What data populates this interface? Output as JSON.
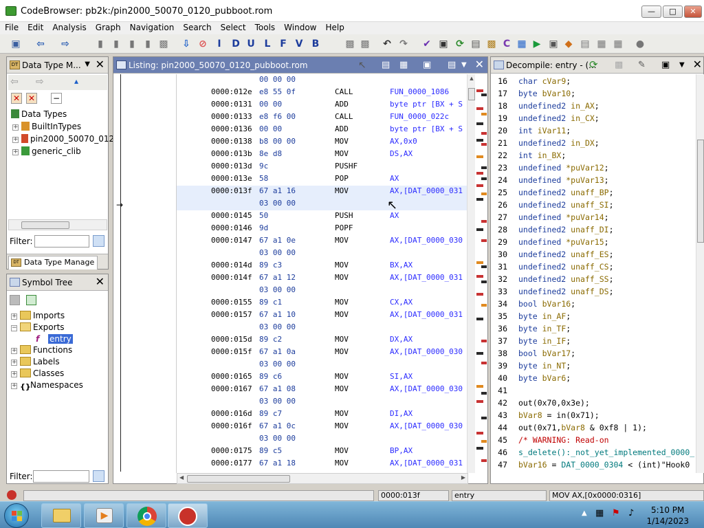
{
  "window": {
    "title": "CodeBrowser: pb2k:/pin2000_50070_0120_pubboot.rom"
  },
  "menu": [
    "File",
    "Edit",
    "Analysis",
    "Graph",
    "Navigation",
    "Search",
    "Select",
    "Tools",
    "Window",
    "Help"
  ],
  "toolbar_icons": [
    "save-icon",
    "back-icon",
    "forward-icon",
    "disassemble-icon",
    "clear-icon",
    "flow-icon",
    "instruction-icon",
    "data-icon",
    "undefined-icon",
    "label-icon",
    "function-icon",
    "variable-icon",
    "bookmark-icon",
    "undo-icon",
    "redo-icon",
    "checkmark-icon",
    "search-icon",
    "code-icon",
    "data-type-manager-icon",
    "run-icon",
    "debug-icon"
  ],
  "toolbar_letters": {
    "I": "I",
    "D": "D",
    "U": "U",
    "L": "L",
    "F": "F",
    "V": "V",
    "B": "B"
  },
  "datatype": {
    "title": "Data Type M...",
    "tab_label": "Data Type Manage",
    "filter_label": "Filter:",
    "items": [
      {
        "label": "Data Types"
      },
      {
        "label": "BuiltInTypes"
      },
      {
        "label": "pin2000_50070_012"
      },
      {
        "label": "generic_clib"
      }
    ]
  },
  "symbol_tree": {
    "title": "Symbol Tree",
    "filter_label": "Filter:",
    "items": [
      {
        "label": "Imports"
      },
      {
        "label": "Exports"
      },
      {
        "label": "entry"
      },
      {
        "label": "Functions"
      },
      {
        "label": "Labels"
      },
      {
        "label": "Classes"
      },
      {
        "label": "Namespaces"
      }
    ]
  },
  "listing": {
    "title": "Listing:  pin2000_50070_0120_pubboot.rom",
    "rows": [
      {
        "addr": "",
        "bytes": "00 00 00",
        "mnem": "",
        "ops": ""
      },
      {
        "addr": "0000:012e",
        "bytes": "e8 55 0f",
        "mnem": "CALL",
        "ops": "FUN_0000_1086"
      },
      {
        "addr": "0000:0131",
        "bytes": "00 00",
        "mnem": "ADD",
        "ops": "byte ptr [BX + S"
      },
      {
        "addr": "0000:0133",
        "bytes": "e8 f6 00",
        "mnem": "CALL",
        "ops": "FUN_0000_022c"
      },
      {
        "addr": "0000:0136",
        "bytes": "00 00",
        "mnem": "ADD",
        "ops": "byte ptr [BX + S"
      },
      {
        "addr": "0000:0138",
        "bytes": "b8 00 00",
        "mnem": "MOV",
        "ops": "AX,0x0"
      },
      {
        "addr": "0000:013b",
        "bytes": "8e d8",
        "mnem": "MOV",
        "ops": "DS,AX"
      },
      {
        "addr": "0000:013d",
        "bytes": "9c",
        "mnem": "PUSHF",
        "ops": ""
      },
      {
        "addr": "0000:013e",
        "bytes": "58",
        "mnem": "POP",
        "ops": "AX"
      },
      {
        "addr": "0000:013f",
        "bytes": "67 a1 16",
        "mnem": "MOV",
        "ops": "AX,[DAT_0000_031"
      },
      {
        "addr": "",
        "bytes": "03 00 00",
        "mnem": "",
        "ops": ""
      },
      {
        "addr": "0000:0145",
        "bytes": "50",
        "mnem": "PUSH",
        "ops": "AX"
      },
      {
        "addr": "0000:0146",
        "bytes": "9d",
        "mnem": "POPF",
        "ops": ""
      },
      {
        "addr": "0000:0147",
        "bytes": "67 a1 0e",
        "mnem": "MOV",
        "ops": "AX,[DAT_0000_030"
      },
      {
        "addr": "",
        "bytes": "03 00 00",
        "mnem": "",
        "ops": ""
      },
      {
        "addr": "0000:014d",
        "bytes": "89 c3",
        "mnem": "MOV",
        "ops": "BX,AX"
      },
      {
        "addr": "0000:014f",
        "bytes": "67 a1 12",
        "mnem": "MOV",
        "ops": "AX,[DAT_0000_031"
      },
      {
        "addr": "",
        "bytes": "03 00 00",
        "mnem": "",
        "ops": ""
      },
      {
        "addr": "0000:0155",
        "bytes": "89 c1",
        "mnem": "MOV",
        "ops": "CX,AX"
      },
      {
        "addr": "0000:0157",
        "bytes": "67 a1 10",
        "mnem": "MOV",
        "ops": "AX,[DAT_0000_031"
      },
      {
        "addr": "",
        "bytes": "03 00 00",
        "mnem": "",
        "ops": ""
      },
      {
        "addr": "0000:015d",
        "bytes": "89 c2",
        "mnem": "MOV",
        "ops": "DX,AX"
      },
      {
        "addr": "0000:015f",
        "bytes": "67 a1 0a",
        "mnem": "MOV",
        "ops": "AX,[DAT_0000_030"
      },
      {
        "addr": "",
        "bytes": "03 00 00",
        "mnem": "",
        "ops": ""
      },
      {
        "addr": "0000:0165",
        "bytes": "89 c6",
        "mnem": "MOV",
        "ops": "SI,AX"
      },
      {
        "addr": "0000:0167",
        "bytes": "67 a1 08",
        "mnem": "MOV",
        "ops": "AX,[DAT_0000_030"
      },
      {
        "addr": "",
        "bytes": "03 00 00",
        "mnem": "",
        "ops": ""
      },
      {
        "addr": "0000:016d",
        "bytes": "89 c7",
        "mnem": "MOV",
        "ops": "DI,AX"
      },
      {
        "addr": "0000:016f",
        "bytes": "67 a1 0c",
        "mnem": "MOV",
        "ops": "AX,[DAT_0000_030"
      },
      {
        "addr": "",
        "bytes": "03 00 00",
        "mnem": "",
        "ops": ""
      },
      {
        "addr": "0000:0175",
        "bytes": "89 c5",
        "mnem": "MOV",
        "ops": "BP,AX"
      },
      {
        "addr": "0000:0177",
        "bytes": "67 a1 18",
        "mnem": "MOV",
        "ops": "AX,[DAT_0000_031"
      }
    ]
  },
  "decompile": {
    "title": "Decompile: entry - (...",
    "rows": [
      {
        "n": "16",
        "code": [
          {
            "t": "char ",
            "c": "kw"
          },
          {
            "t": "cVar9",
            "c": "vr"
          },
          {
            "t": ";",
            "c": ""
          }
        ]
      },
      {
        "n": "17",
        "code": [
          {
            "t": "byte ",
            "c": "kw"
          },
          {
            "t": "bVar10",
            "c": "vr"
          },
          {
            "t": ";",
            "c": ""
          }
        ]
      },
      {
        "n": "18",
        "code": [
          {
            "t": "undefined2 ",
            "c": "kw"
          },
          {
            "t": "in_AX",
            "c": "vr"
          },
          {
            "t": ";",
            "c": ""
          }
        ]
      },
      {
        "n": "19",
        "code": [
          {
            "t": "undefined2 ",
            "c": "kw"
          },
          {
            "t": "in_CX",
            "c": "vr"
          },
          {
            "t": ";",
            "c": ""
          }
        ]
      },
      {
        "n": "20",
        "code": [
          {
            "t": "int ",
            "c": "kw"
          },
          {
            "t": "iVar11",
            "c": "vr"
          },
          {
            "t": ";",
            "c": ""
          }
        ]
      },
      {
        "n": "21",
        "code": [
          {
            "t": "undefined2 ",
            "c": "kw"
          },
          {
            "t": "in_DX",
            "c": "vr"
          },
          {
            "t": ";",
            "c": ""
          }
        ]
      },
      {
        "n": "22",
        "code": [
          {
            "t": "int ",
            "c": "kw"
          },
          {
            "t": "in_BX",
            "c": "vr"
          },
          {
            "t": ";",
            "c": ""
          }
        ]
      },
      {
        "n": "23",
        "code": [
          {
            "t": "undefined ",
            "c": "kw"
          },
          {
            "t": "*puVar12",
            "c": "vr"
          },
          {
            "t": ";",
            "c": ""
          }
        ]
      },
      {
        "n": "24",
        "code": [
          {
            "t": "undefined ",
            "c": "kw"
          },
          {
            "t": "*puVar13",
            "c": "vr"
          },
          {
            "t": ";",
            "c": ""
          }
        ]
      },
      {
        "n": "25",
        "code": [
          {
            "t": "undefined2 ",
            "c": "kw"
          },
          {
            "t": "unaff_BP",
            "c": "vr"
          },
          {
            "t": ";",
            "c": ""
          }
        ]
      },
      {
        "n": "26",
        "code": [
          {
            "t": "undefined2 ",
            "c": "kw"
          },
          {
            "t": "unaff_SI",
            "c": "vr"
          },
          {
            "t": ";",
            "c": ""
          }
        ]
      },
      {
        "n": "27",
        "code": [
          {
            "t": "undefined ",
            "c": "kw"
          },
          {
            "t": "*puVar14",
            "c": "vr"
          },
          {
            "t": ";",
            "c": ""
          }
        ]
      },
      {
        "n": "28",
        "code": [
          {
            "t": "undefined2 ",
            "c": "kw"
          },
          {
            "t": "unaff_DI",
            "c": "vr"
          },
          {
            "t": ";",
            "c": ""
          }
        ]
      },
      {
        "n": "29",
        "code": [
          {
            "t": "undefined ",
            "c": "kw"
          },
          {
            "t": "*puVar15",
            "c": "vr"
          },
          {
            "t": ";",
            "c": ""
          }
        ]
      },
      {
        "n": "30",
        "code": [
          {
            "t": "undefined2 ",
            "c": "kw"
          },
          {
            "t": "unaff_ES",
            "c": "vr"
          },
          {
            "t": ";",
            "c": ""
          }
        ]
      },
      {
        "n": "31",
        "code": [
          {
            "t": "undefined2 ",
            "c": "kw"
          },
          {
            "t": "unaff_CS",
            "c": "vr"
          },
          {
            "t": ";",
            "c": ""
          }
        ]
      },
      {
        "n": "32",
        "code": [
          {
            "t": "undefined2 ",
            "c": "kw"
          },
          {
            "t": "unaff_SS",
            "c": "vr"
          },
          {
            "t": ";",
            "c": ""
          }
        ]
      },
      {
        "n": "33",
        "code": [
          {
            "t": "undefined2 ",
            "c": "kw"
          },
          {
            "t": "unaff_DS",
            "c": "vr"
          },
          {
            "t": ";",
            "c": ""
          }
        ]
      },
      {
        "n": "34",
        "code": [
          {
            "t": "bool ",
            "c": "kw"
          },
          {
            "t": "bVar16",
            "c": "vr"
          },
          {
            "t": ";",
            "c": ""
          }
        ]
      },
      {
        "n": "35",
        "code": [
          {
            "t": "byte ",
            "c": "kw"
          },
          {
            "t": "in_AF",
            "c": "vr"
          },
          {
            "t": ";",
            "c": ""
          }
        ]
      },
      {
        "n": "36",
        "code": [
          {
            "t": "byte ",
            "c": "kw"
          },
          {
            "t": "in_TF",
            "c": "vr"
          },
          {
            "t": ";",
            "c": ""
          }
        ]
      },
      {
        "n": "37",
        "code": [
          {
            "t": "byte ",
            "c": "kw"
          },
          {
            "t": "in_IF",
            "c": "vr"
          },
          {
            "t": ";",
            "c": ""
          }
        ]
      },
      {
        "n": "38",
        "code": [
          {
            "t": "bool ",
            "c": "kw"
          },
          {
            "t": "bVar17",
            "c": "vr"
          },
          {
            "t": ";",
            "c": ""
          }
        ]
      },
      {
        "n": "39",
        "code": [
          {
            "t": "byte ",
            "c": "kw"
          },
          {
            "t": "in_NT",
            "c": "vr"
          },
          {
            "t": ";",
            "c": ""
          }
        ]
      },
      {
        "n": "40",
        "code": [
          {
            "t": "byte ",
            "c": "kw"
          },
          {
            "t": "bVar6",
            "c": "vr"
          },
          {
            "t": ";",
            "c": ""
          }
        ]
      },
      {
        "n": "41",
        "code": []
      },
      {
        "n": "42",
        "code": [
          {
            "t": "out(0x70,0x3e);",
            "c": ""
          }
        ]
      },
      {
        "n": "43",
        "code": [
          {
            "t": "bVar8",
            "c": "vr"
          },
          {
            "t": " = in(0x71);",
            "c": ""
          }
        ]
      },
      {
        "n": "44",
        "code": [
          {
            "t": "out(0x71,",
            "c": ""
          },
          {
            "t": "bVar8",
            "c": "vr"
          },
          {
            "t": " & 0xf8 | 1);",
            "c": ""
          }
        ]
      },
      {
        "n": "45",
        "code": [
          {
            "t": "                  /* WARNING: Read-on",
            "c": "cm"
          }
        ]
      },
      {
        "n": "46",
        "code": [
          {
            "t": "s_delete():_not_yet_implemented_0000_",
            "c": "gv"
          }
        ]
      },
      {
        "n": "47",
        "code": [
          {
            "t": "bVar16",
            "c": "vr"
          },
          {
            "t": " = ",
            "c": ""
          },
          {
            "t": "DAT_0000_0304",
            "c": "gv"
          },
          {
            "t": " < (int)\"Hook0",
            "c": ""
          }
        ]
      }
    ]
  },
  "status": {
    "address": "0000:013f",
    "function": "entry",
    "instruction": "MOV AX,[0x0000:0316]"
  },
  "clock": {
    "time": "5:10 PM",
    "date": "1/14/2023"
  },
  "colors": {
    "accent": "#6b7fb1",
    "keyword": "#1c3c9c",
    "variable": "#8a6a00",
    "global": "#00797c",
    "comment": "#c00000",
    "highlight_row": "#e6eefc"
  }
}
